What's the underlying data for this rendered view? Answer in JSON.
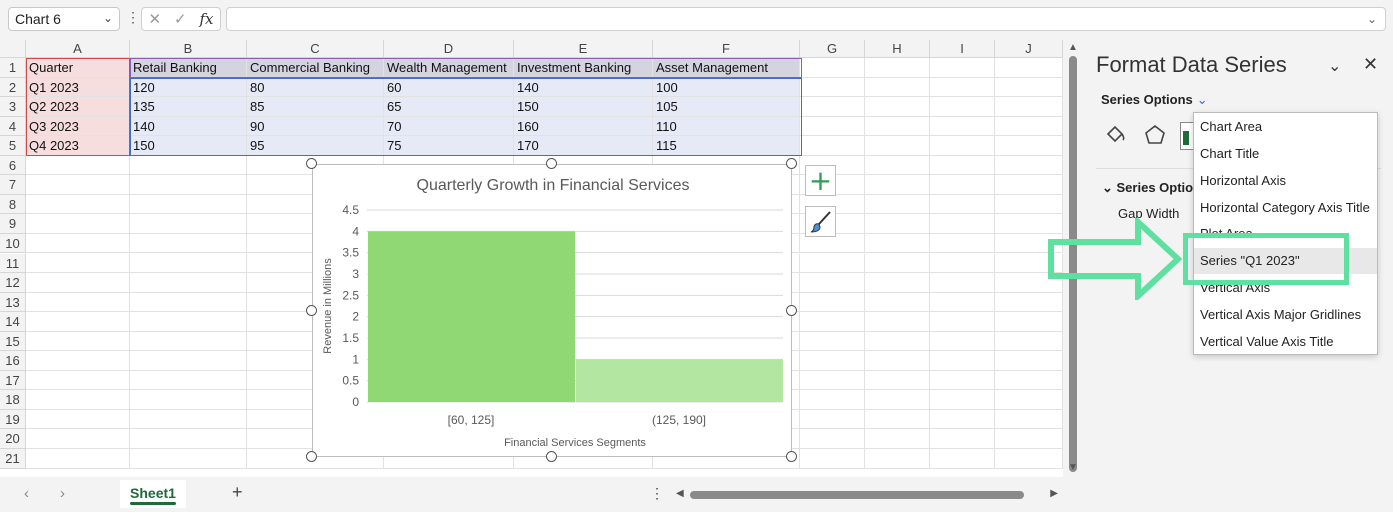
{
  "formula_bar": {
    "name_box": "Chart 6",
    "formula": "",
    "cancel_icon": "close-icon",
    "enter_icon": "check-icon",
    "function_icon": "fx-icon",
    "fx_label": "fx"
  },
  "sheet": {
    "columns": [
      "A",
      "B",
      "C",
      "D",
      "E",
      "F",
      "G",
      "H",
      "I",
      "J"
    ],
    "rows": [
      "1",
      "2",
      "3",
      "4",
      "5",
      "6",
      "7",
      "8",
      "9",
      "10",
      "11",
      "12",
      "13",
      "14",
      "15",
      "16",
      "17",
      "18",
      "19",
      "20",
      "21"
    ],
    "table": {
      "header": [
        "Quarter",
        "Retail Banking",
        "Commercial Banking",
        "Wealth Management",
        "Investment Banking",
        "Asset Management"
      ],
      "data": [
        [
          "Q1 2023",
          "120",
          "80",
          "60",
          "140",
          "100"
        ],
        [
          "Q2 2023",
          "135",
          "85",
          "65",
          "150",
          "105"
        ],
        [
          "Q3 2023",
          "140",
          "90",
          "70",
          "160",
          "110"
        ],
        [
          "Q4 2023",
          "150",
          "95",
          "75",
          "170",
          "115"
        ]
      ]
    }
  },
  "chart": {
    "plus_icon": "plus-icon",
    "brush_icon": "paintbrush-icon"
  },
  "chart_data": {
    "type": "bar",
    "title": "Quarterly Growth in Financial Services",
    "xlabel": "Financial Services Segments",
    "ylabel": "Revenue in Millions",
    "categories": [
      "[60, 125]",
      "(125, 190]"
    ],
    "values": [
      4,
      1
    ],
    "ylim": [
      0,
      4.5
    ],
    "yticks": [
      "0",
      "0.5",
      "1",
      "1.5",
      "2",
      "2.5",
      "3",
      "3.5",
      "4",
      "4.5"
    ],
    "colors": [
      "#8fd874",
      "#b3e6a0"
    ],
    "grid": true,
    "legend": "none"
  },
  "tabs": {
    "sheet_name": "Sheet1",
    "add_icon": "plus-icon",
    "prev_icon": "chevron-left-icon",
    "next_icon": "chevron-right-icon"
  },
  "pane": {
    "title": "Format Data Series",
    "series_options_label": "Series Options",
    "section_label": "Series Optio",
    "gap_width_label": "Gap Width",
    "icons": [
      "fill-bucket-icon",
      "pentagon-icon",
      "bar-chart-icon"
    ]
  },
  "dropdown": {
    "items": [
      "Chart Area",
      "Chart Title",
      "Horizontal Axis",
      "Horizontal Category Axis Title",
      "Plot Area",
      "Series \"Q1 2023\"",
      "Vertical Axis",
      "Vertical Axis Major Gridlines",
      "Vertical Value Axis Title"
    ],
    "selected": "Series \"Q1 2023\""
  },
  "annotation": {
    "color": "#5fe0a0"
  }
}
